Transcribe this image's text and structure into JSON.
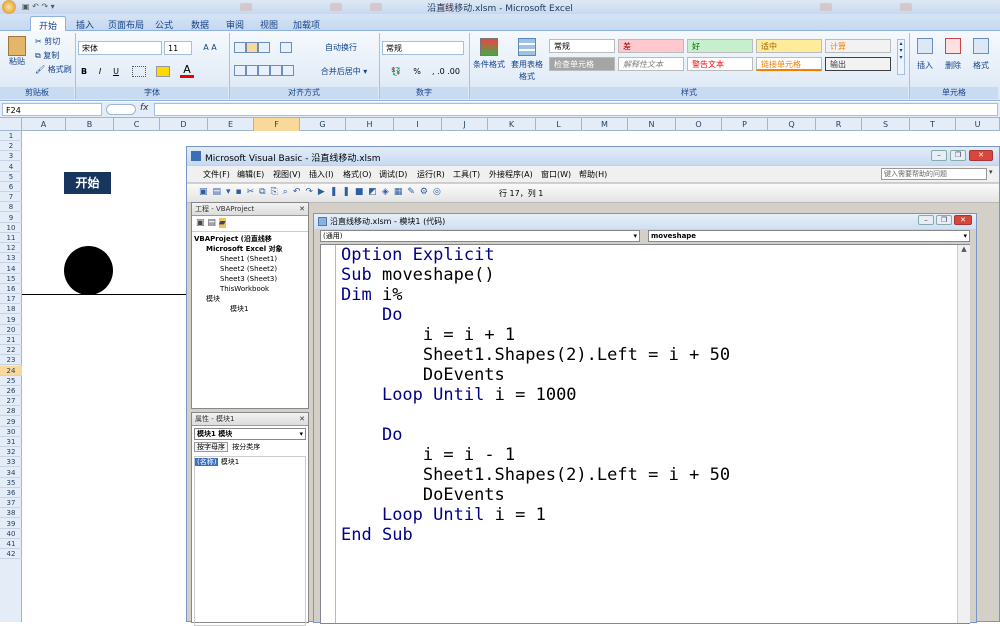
{
  "window_title": "沿直线移动.xlsm - Microsoft Excel",
  "ribbon_tabs": [
    "开始",
    "插入",
    "页面布局",
    "公式",
    "数据",
    "审阅",
    "视图",
    "加载项"
  ],
  "clipboard": {
    "paste": "粘贴",
    "cut": "剪切",
    "copy": "复制",
    "format_painter": "格式刷",
    "label": "剪贴板"
  },
  "font": {
    "name": "宋体",
    "size": "11",
    "bold": "B",
    "italic": "I",
    "underline": "U",
    "label": "字体"
  },
  "alignment": {
    "wrap": "自动换行",
    "merge": "合并后居中 ▾",
    "label": "对齐方式"
  },
  "number": {
    "format": "常规",
    "percent": "%",
    "label": "数字"
  },
  "styles": {
    "conditional": "条件格式",
    "table": "套用表格格式",
    "cells": [
      {
        "text": "常规",
        "bg": "#ffffff",
        "fg": "#000000"
      },
      {
        "text": "差",
        "bg": "#ffc7ce",
        "fg": "#9c0006"
      },
      {
        "text": "好",
        "bg": "#c6efce",
        "fg": "#006100"
      },
      {
        "text": "适中",
        "bg": "#ffeb9c",
        "fg": "#9c6500"
      },
      {
        "text": "计算",
        "bg": "#f2f2f2",
        "fg": "#fa7d00"
      },
      {
        "text": "检查单元格",
        "bg": "#a5a5a5",
        "fg": "#ffffff"
      },
      {
        "text": "解释性文本",
        "bg": "#ffffff",
        "fg": "#7f7f7f"
      },
      {
        "text": "警告文本",
        "bg": "#ffffff",
        "fg": "#ff0000"
      },
      {
        "text": "链接单元格",
        "bg": "#ffffff",
        "fg": "#fa7d00"
      },
      {
        "text": "输出",
        "bg": "#f2f2f2",
        "fg": "#3f3f3f"
      }
    ],
    "label": "样式"
  },
  "cells_group": {
    "insert": "插入",
    "delete": "删除",
    "format": "格式",
    "label": "单元格"
  },
  "formula_bar": {
    "name_box": "F24",
    "fx": "fx"
  },
  "columns": [
    "A",
    "B",
    "C",
    "D",
    "E",
    "F",
    "G",
    "H",
    "I",
    "J",
    "K",
    "L",
    "M",
    "N",
    "O",
    "P",
    "Q",
    "R",
    "S",
    "T",
    "U"
  ],
  "rows": [
    "1",
    "2",
    "3",
    "4",
    "5",
    "6",
    "7",
    "8",
    "9",
    "10",
    "11",
    "12",
    "13",
    "14",
    "15",
    "16",
    "17",
    "18",
    "19",
    "20",
    "21",
    "22",
    "23",
    "24",
    "25",
    "26",
    "27",
    "28",
    "29",
    "30",
    "31",
    "32",
    "33",
    "34",
    "35",
    "36",
    "37",
    "38",
    "39",
    "40",
    "41",
    "42"
  ],
  "start_button": "开始",
  "vba": {
    "title": "Microsoft Visual Basic - 沿直线移动.xlsm",
    "menus": [
      "文件(F)",
      "编辑(E)",
      "视图(V)",
      "插入(I)",
      "格式(O)",
      "调试(D)",
      "运行(R)",
      "工具(T)",
      "外接程序(A)",
      "窗口(W)",
      "帮助(H)"
    ],
    "help_box": "键入需要帮助的问题",
    "position": "行 17，列 1",
    "project_title": "工程 - VBAProject",
    "tree": [
      "VBAProject (沿直线移",
      "Microsoft Excel 对象",
      "Sheet1 (Sheet1)",
      "Sheet2 (Sheet2)",
      "Sheet3 (Sheet3)",
      "ThisWorkbook",
      "模块",
      "模块1"
    ],
    "props_title": "属性 - 模块1",
    "props_combo": "模块1 模块",
    "props_tabs": [
      "按字母序",
      "按分类序"
    ],
    "props_name_key": "(名称)",
    "props_name_val": "模块1",
    "code_title": "沿直线移动.xlsm - 模块1 (代码)",
    "code_left_combo": "(通用)",
    "code_right_combo": "moveshape",
    "code_lines": [
      "Option Explicit",
      "Sub moveshape()",
      "Dim i%",
      "    Do",
      "        i = i + 1",
      "        Sheet1.Shapes(2).Left = i + 50",
      "        DoEvents",
      "    Loop Until i = 1000",
      "",
      "    Do",
      "        i = i - 1",
      "        Sheet1.Shapes(2).Left = i + 50",
      "        DoEvents",
      "    Loop Until i = 1",
      "End Sub"
    ]
  }
}
